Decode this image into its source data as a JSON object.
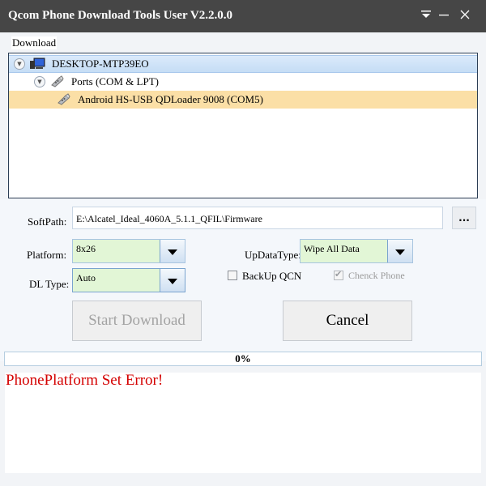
{
  "window": {
    "title": "Qcom Phone Download Tools User V2.2.0.0",
    "controls": {
      "menu_icon": "dropdown-menu-icon",
      "minimize_icon": "minimize-icon",
      "close_icon": "close-icon"
    }
  },
  "download_group": {
    "label": "Download",
    "tree": [
      {
        "label": "DESKTOP-MTP39EO",
        "icon": "computer-icon",
        "expanded": true,
        "state": "selected"
      },
      {
        "label": "Ports (COM & LPT)",
        "icon": "port-icon",
        "expanded": true
      },
      {
        "label": "Android HS-USB QDLoader 9008 (COM5)",
        "icon": "port-icon",
        "state": "highlighted"
      }
    ]
  },
  "settings": {
    "softpath_label": "SoftPath:",
    "softpath_value": "E:\\Alcatel_Ideal_4060A_5.1.1_QFIL\\Firmware",
    "browse_label": "...",
    "platform_label": "Platform:",
    "platform_value": "8x26",
    "dltype_label": "DL Type:",
    "dltype_value": "Auto",
    "updatatype_label": "UpDataType:",
    "updatatype_value": "Wipe All Data",
    "backup_qcn_label": "BackUp QCN",
    "backup_qcn_checked": false,
    "check_phone_label": "Chenck Phone",
    "check_phone_checked": true,
    "check_phone_disabled": true
  },
  "actions": {
    "start_label": "Start Download",
    "start_disabled": true,
    "cancel_label": "Cancel"
  },
  "progress": {
    "value_percent": 0,
    "label": "0%"
  },
  "log": {
    "message": "PhonePlatform Set Error!",
    "color": "#d40000"
  }
}
